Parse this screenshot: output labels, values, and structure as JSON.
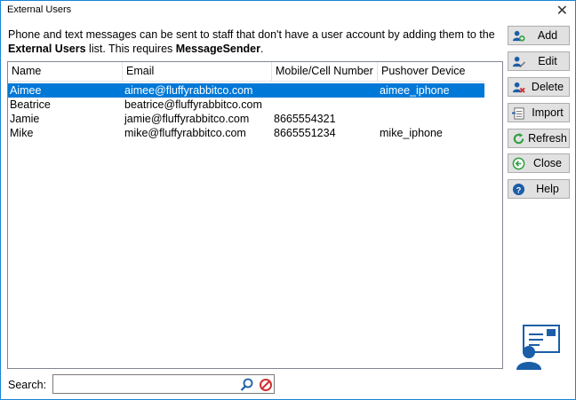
{
  "window": {
    "title": "External Users",
    "close_glyph": "✕"
  },
  "description": {
    "line1": "Phone and text messages can be sent to staff that don't have a user account by adding them to the",
    "bold1": "External Users",
    "mid": " list.  This requires ",
    "bold2": "MessageSender",
    "end": "."
  },
  "table": {
    "columns": [
      "Name",
      "Email",
      "Mobile/Cell Number",
      "Pushover Device"
    ],
    "rows": [
      {
        "name": "Aimee",
        "email": "aimee@fluffyrabbitco.com",
        "mobile": "",
        "pushover": "aimee_iphone",
        "selected": true
      },
      {
        "name": "Beatrice",
        "email": "beatrice@fluffyrabbitco.com",
        "mobile": "",
        "pushover": "",
        "selected": false
      },
      {
        "name": "Jamie",
        "email": "jamie@fluffyrabbitco.com",
        "mobile": "8665554321",
        "pushover": "",
        "selected": false
      },
      {
        "name": "Mike",
        "email": "mike@fluffyrabbitco.com",
        "mobile": "8665551234",
        "pushover": "mike_iphone",
        "selected": false
      }
    ]
  },
  "buttons": {
    "add": "Add",
    "edit": "Edit",
    "delete": "Delete",
    "import": "Import",
    "refresh": "Refresh",
    "close": "Close",
    "help": "Help"
  },
  "search": {
    "label": "Search:",
    "value": "",
    "placeholder": ""
  },
  "colors": {
    "selection": "#0078d7",
    "accent": "#1a5ea8",
    "clear_red": "#d32f2f"
  }
}
